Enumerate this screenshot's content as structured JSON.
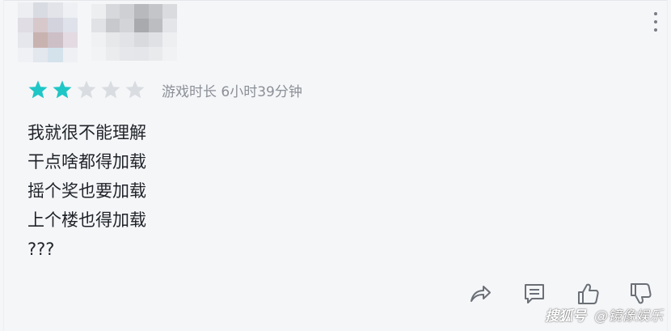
{
  "review": {
    "rating": 2,
    "max_rating": 5,
    "playtime": "游戏时长 6小时39分钟",
    "lines": [
      "我就很不能理解",
      "干点啥都得加载",
      "摇个奖也要加载",
      "上个楼也得加载",
      "???"
    ]
  },
  "colors": {
    "star_filled": "#1fc6c6",
    "star_empty": "#d9dce1",
    "text": "#1f2329",
    "muted": "#8b8f97",
    "icon": "#6b6f76",
    "background": "#f5f6f8"
  },
  "icons": {
    "more": "more-vertical-icon",
    "share": "share-icon",
    "comment": "comment-icon",
    "like": "thumbs-up-icon",
    "dislike": "thumbs-down-icon"
  },
  "watermark": {
    "logo": "搜狐号",
    "text": "@镜像娱乐"
  }
}
